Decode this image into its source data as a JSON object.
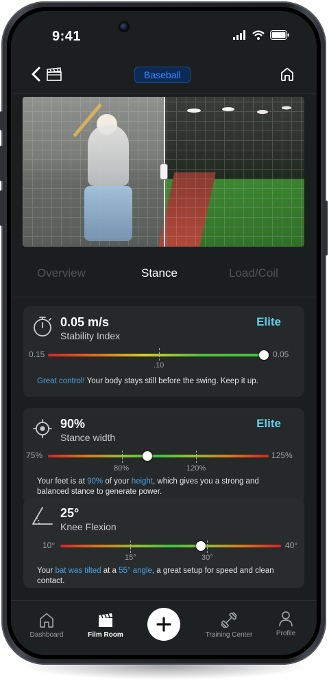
{
  "status_bar": {
    "time": "9:41"
  },
  "header": {
    "sport_pill": "Baseball"
  },
  "tabs": [
    {
      "label": "Overview",
      "active": false
    },
    {
      "label": "Stance",
      "active": true
    },
    {
      "label": "Load/Coil",
      "active": false
    }
  ],
  "metrics": {
    "stability": {
      "value": "0.05 m/s",
      "label": "Stability Index",
      "rating": "Elite",
      "scale_min": "0.15",
      "scale_max": "0.05",
      "tick": ".10",
      "description_highlight": "Great control!",
      "description": " Your body stays still before the swing. Keep it up."
    },
    "stance_width": {
      "value": "90%",
      "label": "Stance width",
      "rating": "Elite",
      "scale_min": "75%",
      "scale_max": "125%",
      "tick_1": "80%",
      "tick_2": "120%",
      "desc_a": "Your feet is at ",
      "desc_b": "90%",
      "desc_c": " of your ",
      "desc_d": "height",
      "desc_e": ", which gives you a strong and balanced stance to generate power."
    },
    "knee_flexion": {
      "value": "25°",
      "label": "Knee Flexion",
      "scale_min": "10°",
      "scale_max": "40°",
      "tick_1": "15°",
      "tick_2": "30°",
      "desc_a": "Your ",
      "desc_b": "bat was tilted",
      "desc_c": " at a ",
      "desc_d": "55° angle",
      "desc_e": ", a great setup for speed and clean contact."
    }
  },
  "bottom_nav": [
    {
      "label": "Dashboard",
      "icon": "home-icon",
      "active": false
    },
    {
      "label": "Film Room",
      "icon": "clapperboard-icon",
      "active": true
    },
    {
      "label": "Training Center",
      "icon": "dumbbell-icon",
      "active": false
    },
    {
      "label": "Profile",
      "icon": "person-icon",
      "active": false
    }
  ],
  "colors": {
    "accent_blue": "#3b8cff",
    "elite": "#5fd0ea",
    "highlight": "#4fa3e6"
  }
}
